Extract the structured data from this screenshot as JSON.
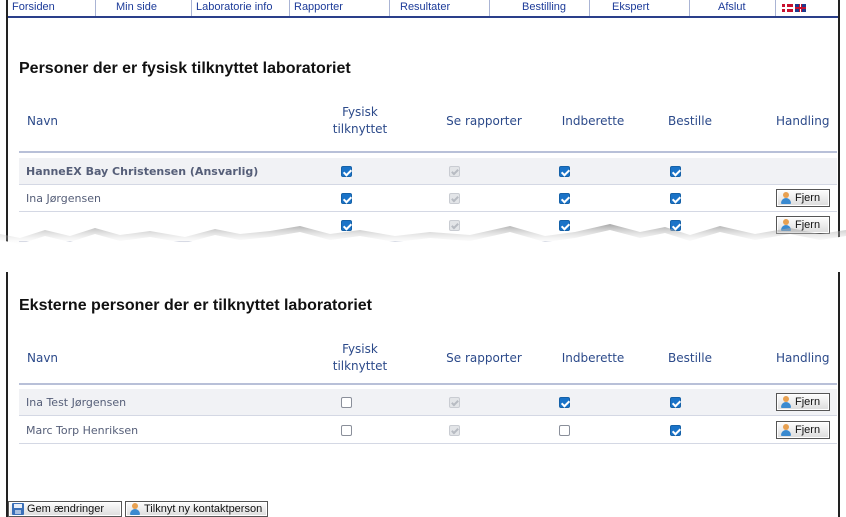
{
  "nav": {
    "items": [
      "Forsiden",
      "Min side",
      "Laboratorie info",
      "Rapporter",
      "Resultater",
      "Bestilling",
      "Ekspert",
      "Afslut"
    ],
    "flags": [
      "danish-flag-icon",
      "uk-flag-icon"
    ]
  },
  "colors": {
    "nav_link": "#1c3b99",
    "header_text": "#2c4a8a",
    "checkbox_checked": "#1a73c8"
  },
  "columns": {
    "name": "Navn",
    "physical_line1": "Fysisk",
    "physical_line2": "tilknyttet",
    "reports": "Se rapporter",
    "submit": "Indberette",
    "order": "Bestille",
    "action": "Handling"
  },
  "section1": {
    "title": "Personer der er fysisk tilknyttet laboratoriet",
    "rows": [
      {
        "name": "HanneEX Bay Christensen (Ansvarlig)",
        "physical": true,
        "reports": true,
        "submit": true,
        "order": true,
        "action": ""
      },
      {
        "name": "Ina Jørgensen",
        "physical": true,
        "reports": true,
        "submit": true,
        "order": true,
        "action": "Fjern"
      },
      {
        "name": "",
        "physical": true,
        "reports": true,
        "submit": true,
        "order": true,
        "action": "Fjern"
      }
    ]
  },
  "section2": {
    "title": "Eksterne personer der er tilknyttet laboratoriet",
    "rows": [
      {
        "name": "Ina Test Jørgensen",
        "physical": false,
        "reports": true,
        "submit": true,
        "order": true,
        "action": "Fjern"
      },
      {
        "name": "Marc Torp Henriksen",
        "physical": false,
        "reports": true,
        "submit": false,
        "order": true,
        "action": "Fjern"
      }
    ]
  },
  "footer": {
    "save_label": "Gem ændringer",
    "add_contact_label": "Tilknyt ny kontaktperson"
  }
}
